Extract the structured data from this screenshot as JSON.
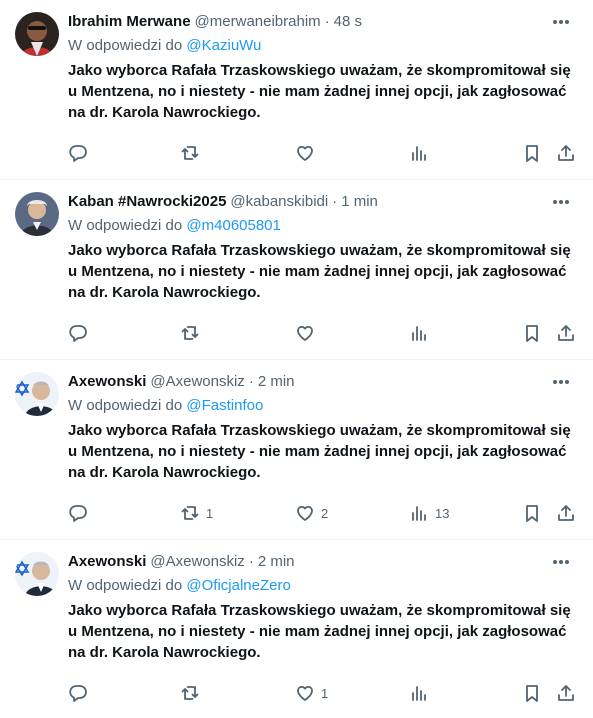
{
  "reply_prefix": "W odpowiedzi do",
  "tweets": [
    {
      "name": "Ibrahim Merwane",
      "handle": "@merwaneibrahim",
      "time": "48 s",
      "reply_to": "@KaziuWu",
      "text": "Jako wyborca Rafała Trzaskowskiego uważam, że skompromitował się u Mentzena, no i niestety - nie mam żadnej innej opcji, jak zagłosować na dr. Karola Nawrockiego.",
      "retweets": "",
      "likes": "",
      "views": ""
    },
    {
      "name": "Kaban #Nawrocki2025",
      "handle": "@kabanskibidi",
      "time": "1 min",
      "reply_to": "@m40605801",
      "text": "Jako wyborca Rafała Trzaskowskiego uważam, że skompromitował się u Mentzena, no i niestety - nie mam żadnej innej opcji, jak zagłosować na dr. Karola Nawrockiego.",
      "retweets": "",
      "likes": "",
      "views": ""
    },
    {
      "name": "Axewonski",
      "handle": "@Axewonskiz",
      "time": "2 min",
      "reply_to": "@Fastinfoo",
      "text": "Jako wyborca Rafała Trzaskowskiego uważam, że skompromitował się u Mentzena, no i niestety - nie mam żadnej innej opcji, jak zagłosować na dr. Karola Nawrockiego.",
      "retweets": "1",
      "likes": "2",
      "views": "13"
    },
    {
      "name": "Axewonski",
      "handle": "@Axewonskiz",
      "time": "2 min",
      "reply_to": "@OficjalneZero",
      "text": "Jako wyborca Rafała Trzaskowskiego uważam, że skompromitował się u Mentzena, no i niestety - nie mam żadnej innej opcji, jak zagłosować na dr. Karola Nawrockiego.",
      "retweets": "",
      "likes": "1",
      "views": ""
    }
  ],
  "colors": {
    "text": "#0f1419",
    "secondary": "#536471",
    "link": "#1d9bf0",
    "divider": "#eff3f4"
  }
}
